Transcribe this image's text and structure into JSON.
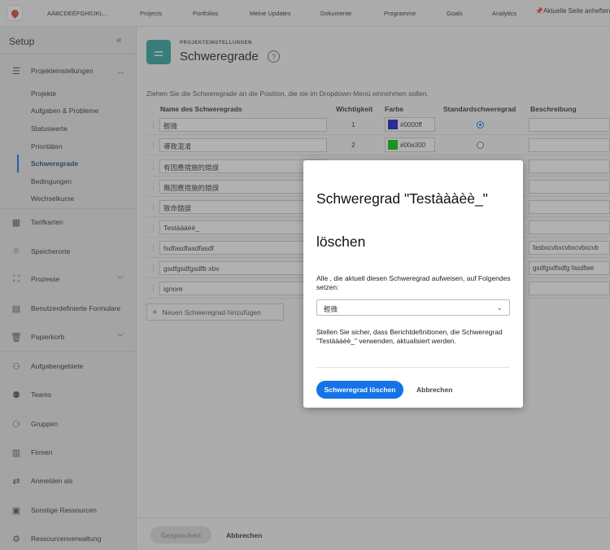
{
  "topbar": {
    "account": "AÄBCDEÉFGHIÏJKL...",
    "nav": [
      "Projects",
      "Portfolios",
      "Meine Updates",
      "Dokumente",
      "Programme",
      "Goals",
      "Analytics"
    ],
    "pin_label": "Aktuelle Seite anheften"
  },
  "sidebar": {
    "title": "Setup",
    "collapse": "«",
    "section": "Projekteinstellungen",
    "sub_items": [
      "Projekte",
      "Aufgaben & Probleme",
      "Statuswerte",
      "Prioritäten",
      "Schweregrade",
      "Bedingungen",
      "Wechselkurse"
    ],
    "items": [
      "Tarifkarten",
      "Speicherorte",
      "Prozesse",
      "Benutzerdefinierte Formulare",
      "Papierkorb",
      "Aufgabengebiete",
      "Teams",
      "Gruppen",
      "Firmen",
      "Anmelden als",
      "Sonstige Ressourcen",
      "Ressourcenverwaltung"
    ]
  },
  "page": {
    "eyebrow": "PROJEKTEINSTELLUNGEN",
    "title": "Schweregrade",
    "instruction": "Ziehen Sie die Schweregrade an die Position, die sie im Dropdown-Menü einnehmen sollen."
  },
  "table": {
    "headers": [
      "Name des Schweregrads",
      "Wichtigkeit",
      "Farbe",
      "Standardschweregrad",
      "Beschreibung"
    ],
    "rows": [
      {
        "name": "輕微",
        "importance": "1",
        "color_hex": "#0000ff",
        "color_label": "#0000ff",
        "default": true,
        "description": ""
      },
      {
        "name": "導致混淆",
        "importance": "2",
        "color_hex": "#00e300",
        "color_label": "#00e300",
        "default": false,
        "description": ""
      },
      {
        "name": "有因應措施的錯誤",
        "importance": "",
        "color_hex": "",
        "color_label": "",
        "default": false,
        "description": ""
      },
      {
        "name": "無因應措施的錯誤",
        "importance": "",
        "color_hex": "",
        "color_label": "",
        "default": false,
        "description": ""
      },
      {
        "name": "致命錯誤",
        "importance": "",
        "color_hex": "",
        "color_label": "",
        "default": false,
        "description": ""
      },
      {
        "name": "Testàààèè_",
        "importance": "",
        "color_hex": "",
        "color_label": "",
        "default": false,
        "description": ""
      },
      {
        "name": "fsdfasdfasdfasdf",
        "importance": "",
        "color_hex": "",
        "color_label": "",
        "default": false,
        "description": "fasbxcvbxcvbxcvbxcvb"
      },
      {
        "name": "gsdfgsdfgsdfb xbv",
        "importance": "",
        "color_hex": "",
        "color_label": "",
        "default": false,
        "description": "gsdfgsdfsdfg  fasdfwe"
      },
      {
        "name": "ignore",
        "importance": "",
        "color_hex": "",
        "color_label": "",
        "default": false,
        "description": ""
      }
    ],
    "add_label": "Neuen Schweregrad hinzufügen"
  },
  "footer": {
    "save_label": "Gespeichert",
    "cancel_label": "Abbrechen"
  },
  "dialog": {
    "title_line1": "Schweregrad \"Testàààèè_\"",
    "title_line2": "löschen",
    "label": "Alle , die aktuell diesen Schweregrad aufweisen, auf Folgendes setzen:",
    "select_value": "輕微",
    "note": "Stellen Sie sicher, dass Berichtdefinitionen, die Schweregrad \"Testàààèè_\" verwenden, aktualisiert werden.",
    "delete_label": "Schweregrad löschen",
    "cancel_label": "Abbrechen"
  }
}
